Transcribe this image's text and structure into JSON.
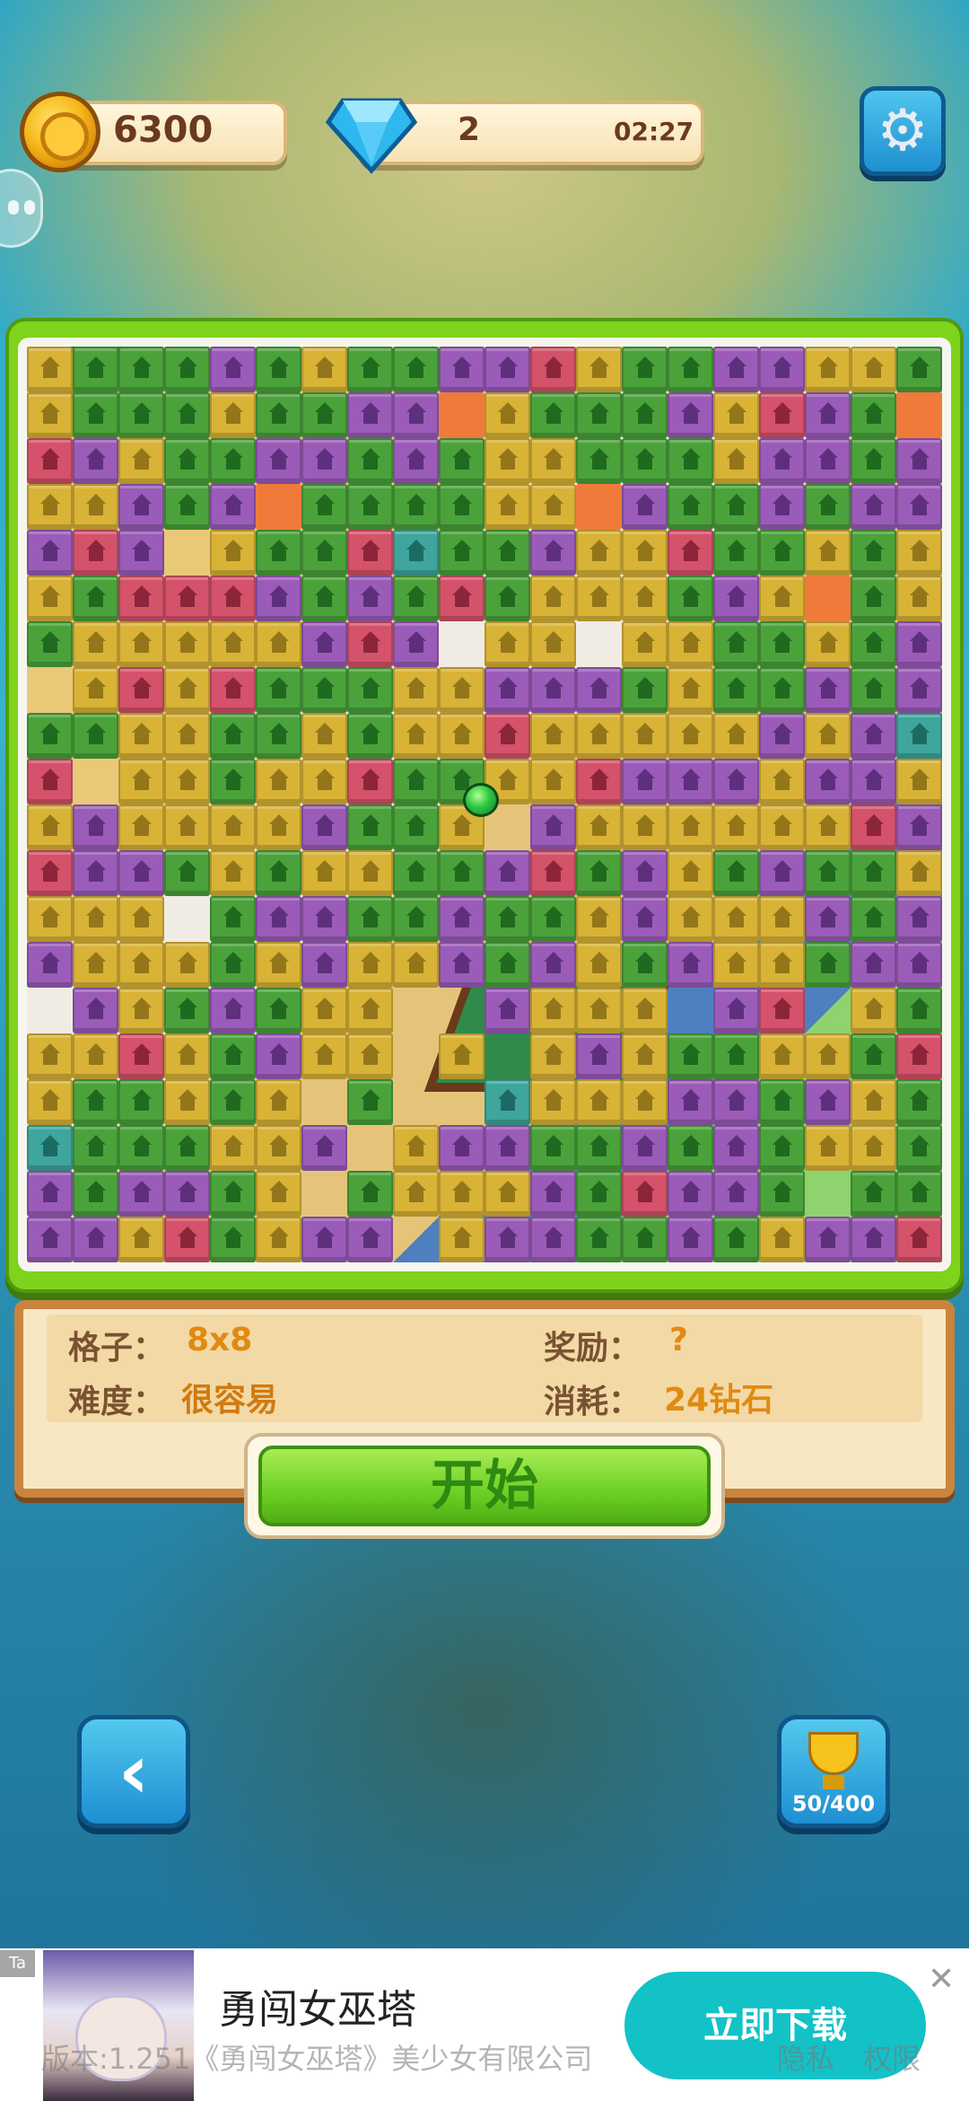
{
  "hud": {
    "coins": "6300",
    "gems": "2",
    "timer": "02:27",
    "icons": [
      "coin-icon",
      "diamond-icon",
      "gear-icon"
    ]
  },
  "board": {
    "rows": [
      "ygggpgyggppryggppyygg",
      "ygggyggppoygggpyrpgo",
      "rpyggppgpgyygggyppgp",
      "yypgpoggggyyopggpgpp",
      "prpeyggrtggpyyrggygy",
      "ygrrrpgpgrgyyygpyogy",
      "gyyyyyprpeyyeyyggygp",
      "eyryrgggyypppgyggpgp",
      "ggyyggygyyryyyyypypt",
      "reyygyyrggyyrpppyppy",
      "ypyyyypggyepyyyyyyrp",
      "rppgygyyggprgpygpggy",
      "yyyegppggpggypyyypgp",
      "pyyygypyypgpygpyygpp",
      "epygpgyyeepyyyepreyg",
      "yyrygpyyeyeypyggyygr",
      "yggygyegeetyyyppgpyg",
      "tgggyypeyppggpgpgyyg",
      "pgppgyegyyypgrppgeggp",
      "ppyrgyppeyppggpgyppr"
    ],
    "marker": "green-ball-marker"
  },
  "info": {
    "grid_label": "格子：",
    "grid_value": "8x8",
    "reward_label": "奖励：",
    "reward_value": "?",
    "difficulty_label": "难度：",
    "difficulty_value": "很容易",
    "cost_label": "消耗：",
    "cost_value": "24钻石"
  },
  "start_label": "开始",
  "back_icon": "‹",
  "trophy": {
    "icon": "trophy-icon",
    "progress": "50/400"
  },
  "ad": {
    "tag": "Ta",
    "title": "勇闯女巫塔",
    "cta": "立即下载",
    "close": "✕",
    "subtitle": "版本:1.251《勇闯女巫塔》美少女有限公司",
    "privacy": "隐私",
    "permissions": "权限"
  },
  "colors": {
    "green_tile": "#4ba23b",
    "yellow_tile": "#d8b336",
    "purple_tile": "#9a5cb8",
    "red_tile": "#d4526a",
    "teal_tile": "#3ea69c",
    "board_border": "#7fd31d",
    "cta": "#12c2c7"
  }
}
